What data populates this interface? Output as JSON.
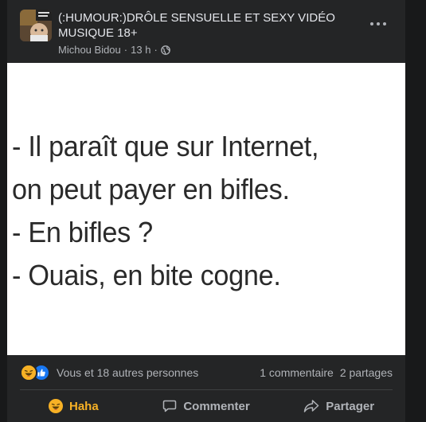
{
  "post": {
    "title": "(:HUMOUR:)DRÔLE SENSUELLE ET SEXY VIDÉO MUSIQUE 18+",
    "author": "Michou Bidou",
    "time": "13 h",
    "separator": "·",
    "privacy_icon": "globe-icon",
    "more_icon": "more-options-icon"
  },
  "image": {
    "lines": [
      "- Il paraît que sur Internet,",
      "on peut payer en bifles.",
      "- En bifles ?",
      "- Ouais, en bite cogne."
    ]
  },
  "stats": {
    "reaction_icons": [
      "haha-icon",
      "like-icon"
    ],
    "reactions_text": "Vous et 18 autres personnes",
    "comments": "1 commentaire",
    "shares": "2 partages"
  },
  "actions": {
    "haha": "Haha",
    "comment": "Commenter",
    "share": "Partager"
  },
  "colors": {
    "background": "#18191a",
    "card": "#242526",
    "text_primary": "#e4e6eb",
    "text_secondary": "#b0b3b8",
    "haha": "#f7b125",
    "like": "#1877f2"
  }
}
